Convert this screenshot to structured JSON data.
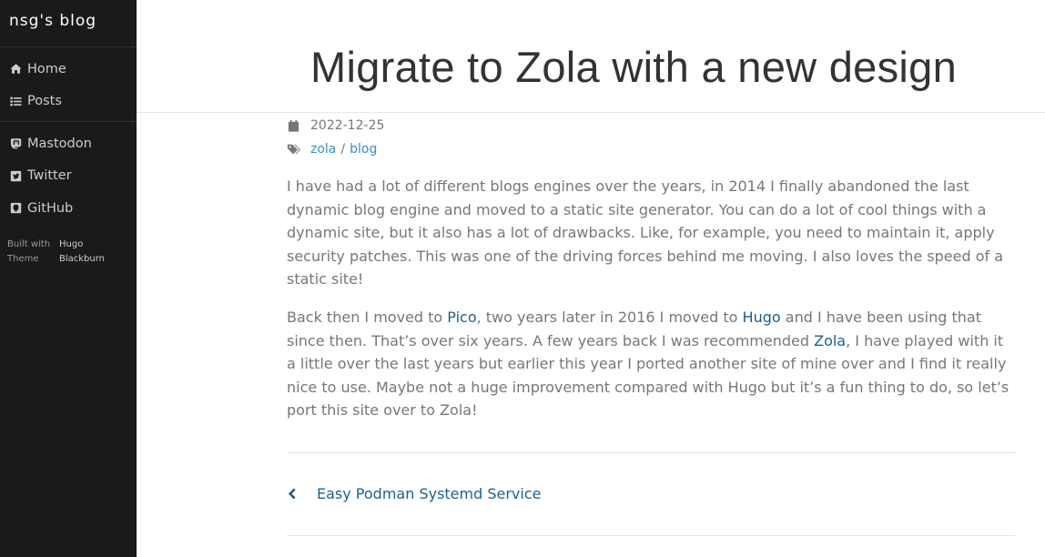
{
  "sidebar": {
    "brand": "nsg's blog",
    "nav": [
      {
        "label": "Home",
        "icon": "home-icon"
      },
      {
        "label": "Posts",
        "icon": "list-icon"
      }
    ],
    "social": [
      {
        "label": "Mastodon",
        "icon": "mastodon-icon"
      },
      {
        "label": "Twitter",
        "icon": "twitter-icon"
      },
      {
        "label": "GitHub",
        "icon": "github-icon"
      }
    ],
    "built_with_label": "Built with",
    "built_with_value": "Hugo",
    "theme_label": "Theme",
    "theme_value": "Blackburn"
  },
  "post": {
    "title": "Migrate to Zola with a new design",
    "date": "2022-12-25",
    "tags": [
      "zola",
      "blog"
    ],
    "tag_separator": "/",
    "p1": "I have had a lot of different blogs engines over the years, in 2014 I finally abandoned the last dynamic blog engine and moved to a static site generator. You can do a lot of cool things with a dynamic site, but it also has a lot of drawbacks. Like, for example, you need to maintain it, apply security patches. This was one of the driving forces behind me moving. I also loves the speed of a static site!",
    "p2": {
      "t1": "Back then I moved to ",
      "link1": "Pico",
      "t2": ", two years later in 2016 I moved to ",
      "link2": "Hugo",
      "t3": " and I have been using that since then. That’s over six years. A few years back I was recommended ",
      "link3": "Zola",
      "t4": ", I have played with it a little over the last years but earlier this year I ported another site of mine over and I find it really nice to use. Maybe not a huge improvement compared with Hugo but it’s a fun thing to do, so let’s port this site over to Zola!"
    },
    "prev_post": "Easy Podman Systemd Service"
  },
  "colors": {
    "sidebar_bg": "#1a1a1a",
    "link": "#1f5f8b",
    "tag_link": "#3b8ec6",
    "body_text": "#777777"
  }
}
